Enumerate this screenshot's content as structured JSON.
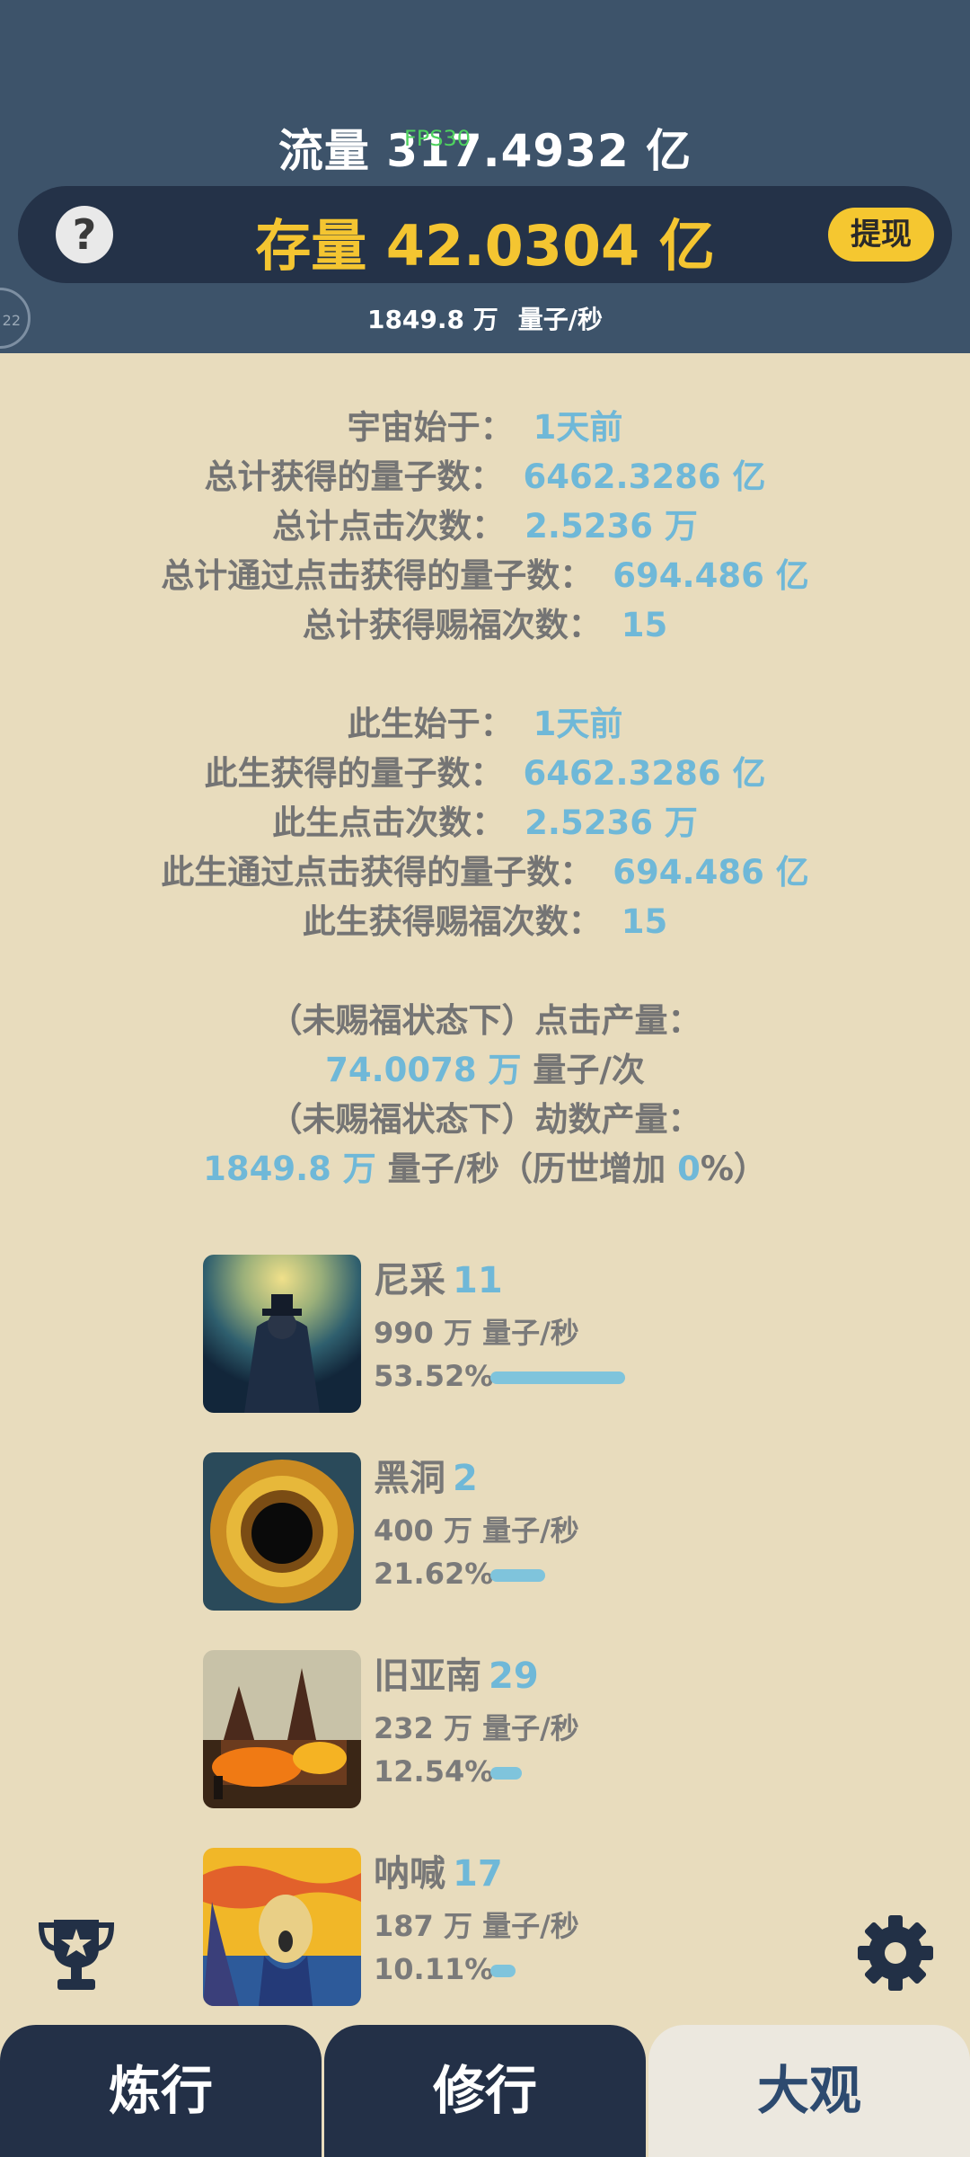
{
  "header": {
    "flow_label": "流量 317.4932 亿",
    "fps": "FPS30",
    "stock_label": "存量 42.0304 亿",
    "withdraw": "提现",
    "help": "?",
    "rate_value": "1849.8 万",
    "rate_unit": "量子/秒",
    "side_badge": "22"
  },
  "stats": {
    "universe_start_label": "宇宙始于：",
    "universe_start_value": "1天前",
    "total_quanta_label": "总计获得的量子数：",
    "total_quanta_value": "6462.3286 亿",
    "total_clicks_label": "总计点击次数：",
    "total_clicks_value": "2.5236 万",
    "total_click_quanta_label": "总计通过点击获得的量子数：",
    "total_click_quanta_value": "694.486 亿",
    "total_blessing_label": "总计获得赐福次数：",
    "total_blessing_value": "15",
    "life_start_label": "此生始于：",
    "life_start_value": "1天前",
    "life_quanta_label": "此生获得的量子数：",
    "life_quanta_value": "6462.3286 亿",
    "life_clicks_label": "此生点击次数：",
    "life_clicks_value": "2.5236 万",
    "life_click_quanta_label": "此生通过点击获得的量子数：",
    "life_click_quanta_value": "694.486 亿",
    "life_blessing_label": "此生获得赐福次数：",
    "life_blessing_value": "15",
    "click_output_label": "（未赐福状态下）点击产量：",
    "click_output_value": "74.0078 万",
    "click_output_unit": " 量子/次",
    "tribulation_label": "（未赐福状态下）劫数产量：",
    "tribulation_value": "1849.8 万",
    "tribulation_unit_a": " 量子/秒（历世增加 ",
    "tribulation_pct": "0",
    "tribulation_unit_b": "%）"
  },
  "buildings": [
    {
      "name": "尼采",
      "level": "11",
      "rate": "990 万 量子/秒",
      "pct": "53.52%",
      "share": 0.5352
    },
    {
      "name": "黑洞",
      "level": "2",
      "rate": "400 万 量子/秒",
      "pct": "21.62%",
      "share": 0.2162
    },
    {
      "name": "旧亚南",
      "level": "29",
      "rate": "232 万 量子/秒",
      "pct": "12.54%",
      "share": 0.1254
    },
    {
      "name": "呐喊",
      "level": "17",
      "rate": "187 万 量子/秒",
      "pct": "10.11%",
      "share": 0.1011
    }
  ],
  "tabs": [
    {
      "label": "炼行"
    },
    {
      "label": "修行"
    },
    {
      "label": "大观"
    }
  ],
  "colors": {
    "header_bg": "#3d536a",
    "accent_gold": "#f4c531",
    "value_blue": "#6fb8d8",
    "page_bg": "#e8dcbd"
  }
}
